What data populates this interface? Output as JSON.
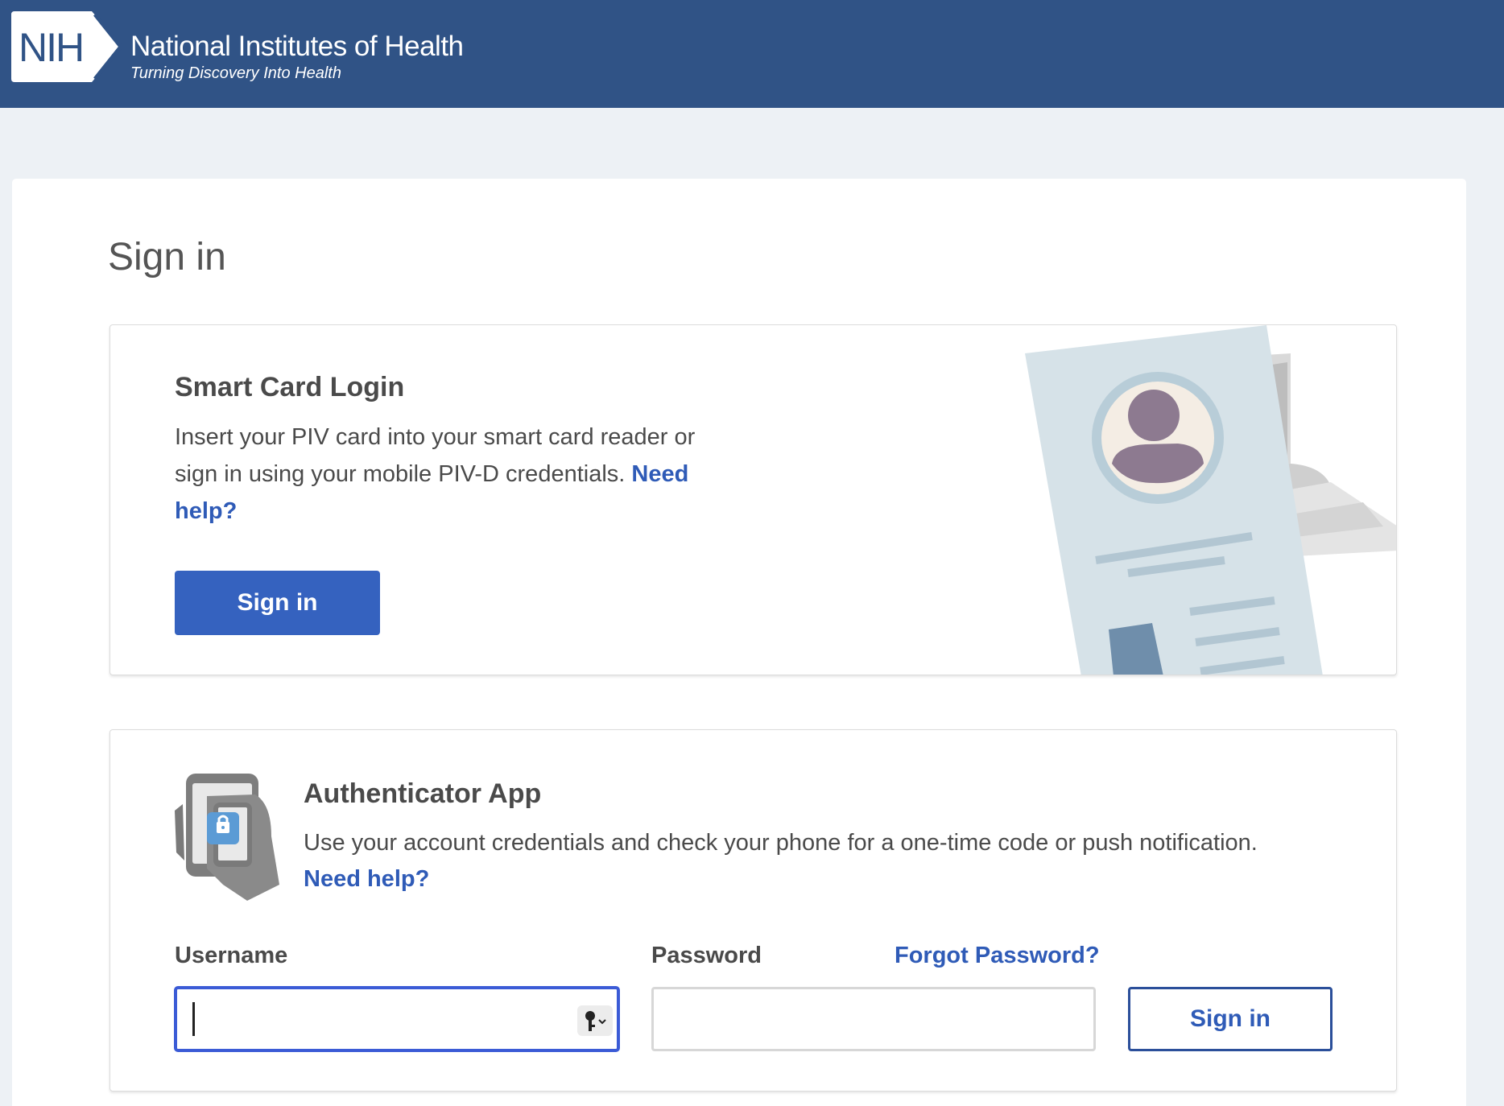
{
  "header": {
    "logo_text": "NIH",
    "org_name": "National Institutes of Health",
    "tagline": "Turning Discovery Into Health"
  },
  "page": {
    "title": "Sign in"
  },
  "smart_card": {
    "title": "Smart Card Login",
    "description": "Insert your PIV card into your smart card reader or sign in using your mobile PIV-D credentials.",
    "help_link": "Need help?",
    "sign_in_label": "Sign in"
  },
  "authenticator": {
    "title": "Authenticator App",
    "description": "Use your account credentials and check your phone for a one-time code or push notification.",
    "help_link": "Need help?",
    "username_label": "Username",
    "username_value": "",
    "password_label": "Password",
    "password_value": "",
    "forgot_password_link": "Forgot Password?",
    "sign_in_label": "Sign in"
  },
  "colors": {
    "header_bg": "#305386",
    "page_bg": "#edf1f5",
    "primary_button": "#3562bf",
    "link": "#2f5bb7",
    "focus_border": "#3b5bd6"
  }
}
